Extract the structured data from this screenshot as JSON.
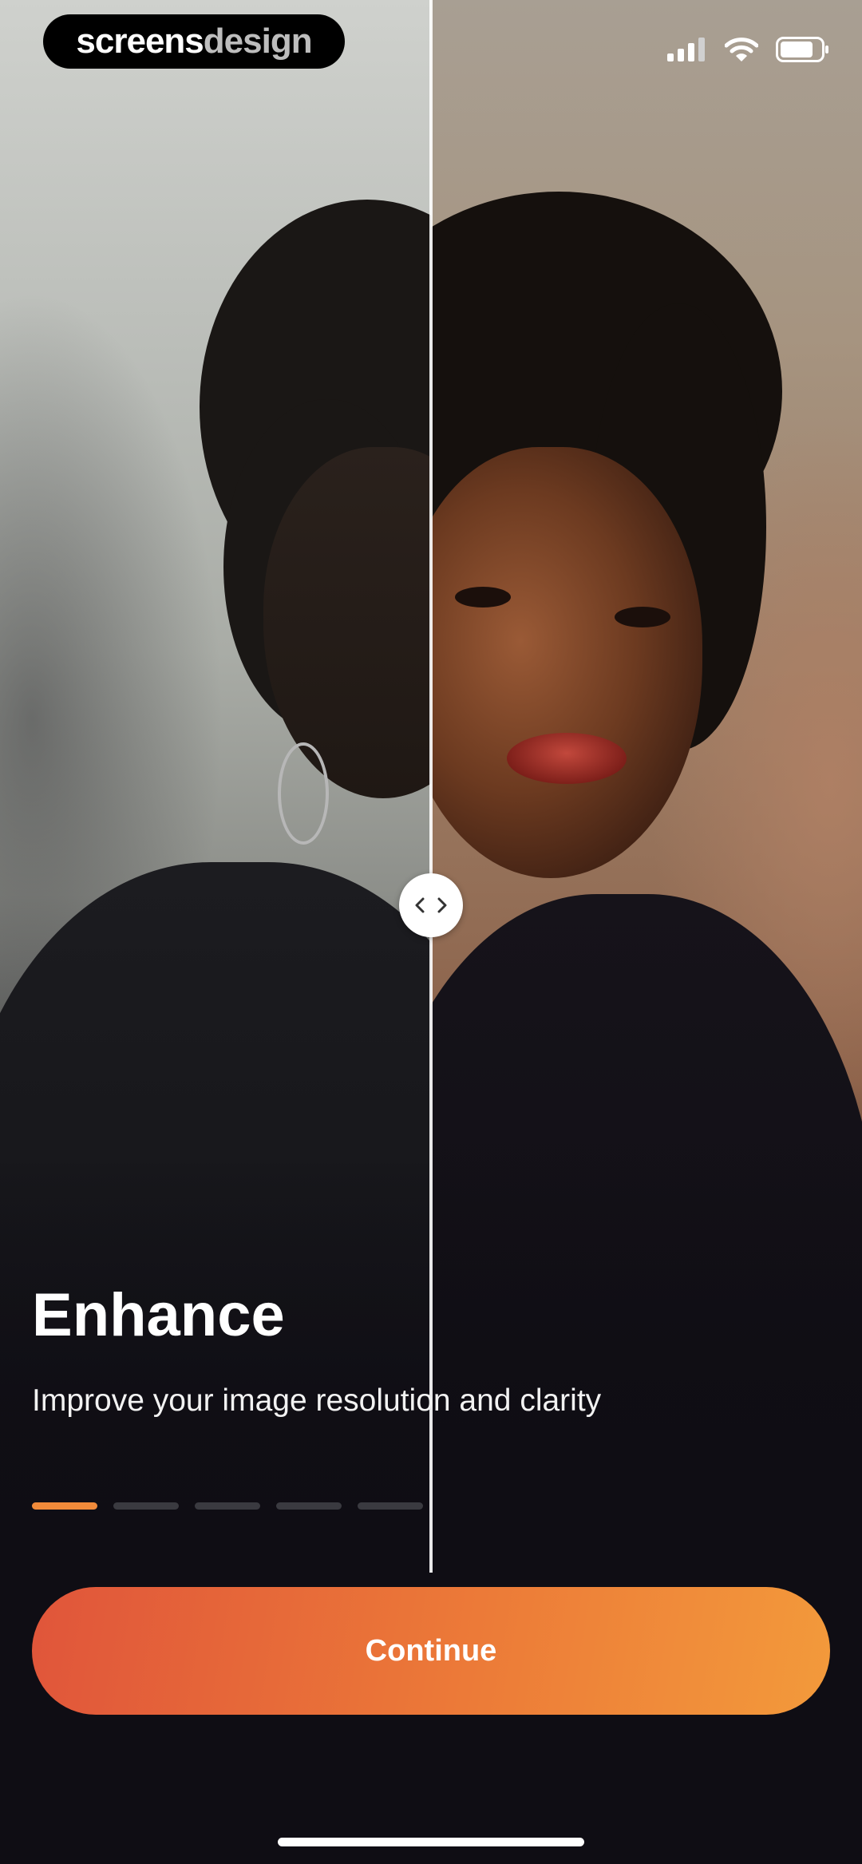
{
  "brand": {
    "name_part1": "screens",
    "name_part2": "design"
  },
  "status_bar": {
    "icons": [
      "cellular-signal-icon",
      "wifi-icon",
      "battery-icon"
    ]
  },
  "comparison": {
    "before_label": "original image",
    "after_label": "enhanced image",
    "handle_icon": "chevrons-left-right-icon"
  },
  "onboarding": {
    "title": "Enhance",
    "subtitle": "Improve your image resolution and clarity",
    "page_count": 5,
    "active_page": 1
  },
  "actions": {
    "continue_label": "Continue"
  },
  "colors": {
    "accent": "#f08a3a",
    "button_start": "#e0553a",
    "button_end": "#f39a3b",
    "background": "#0f0d14"
  }
}
